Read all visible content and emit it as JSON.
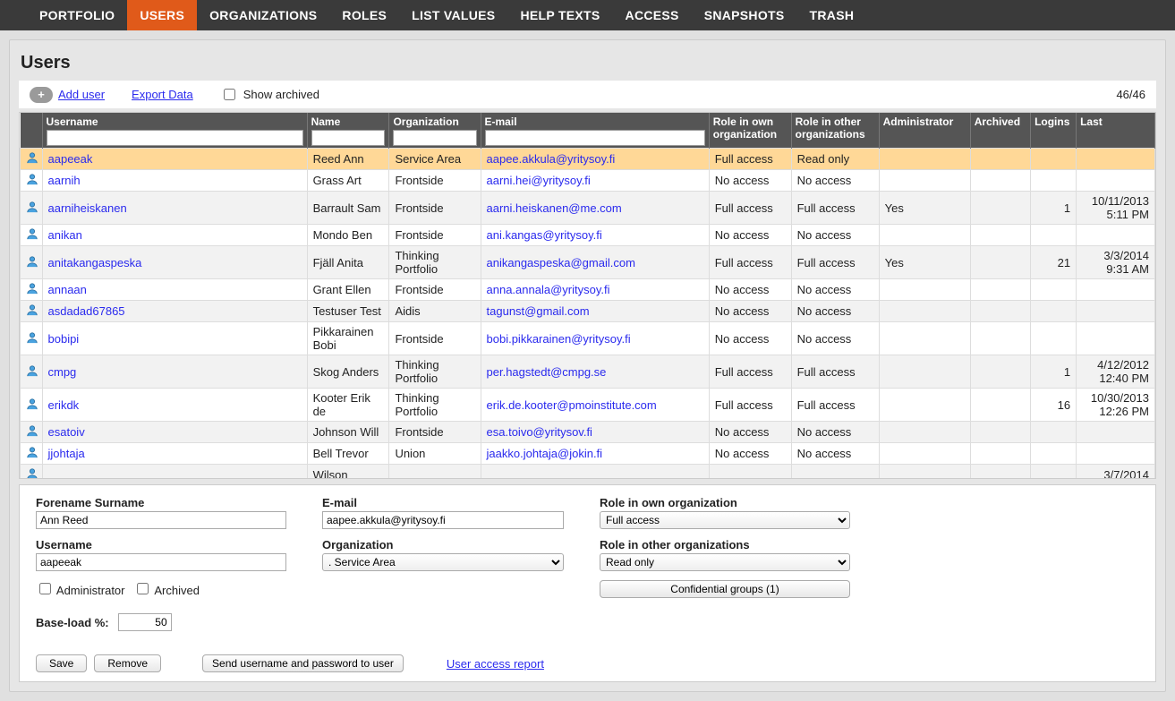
{
  "nav": {
    "items": [
      "PORTFOLIO",
      "USERS",
      "ORGANIZATIONS",
      "ROLES",
      "LIST VALUES",
      "HELP TEXTS",
      "ACCESS",
      "SNAPSHOTS",
      "TRASH"
    ],
    "active_index": 1
  },
  "page_title": "Users",
  "toolbar": {
    "add_user": "Add user",
    "export_data": "Export Data",
    "show_archived_label": "Show archived",
    "show_archived_checked": false,
    "count": "46/46"
  },
  "columns": {
    "username": "Username",
    "name": "Name",
    "organization": "Organization",
    "email": "E-mail",
    "role_own": "Role in own organization",
    "role_other": "Role in other organizations",
    "admin": "Administrator",
    "archived": "Archived",
    "logins": "Logins",
    "last": "Last"
  },
  "rows": [
    {
      "username": "aapeeak",
      "name": "Reed Ann",
      "org": "Service Area",
      "email": "aapee.akkula@yritysoy.fi",
      "role_own": "Full access",
      "role_other": "Read only",
      "admin": "",
      "archived": "",
      "logins": "",
      "last": "",
      "selected": true
    },
    {
      "username": "aarnih",
      "name": "Grass Art",
      "org": "Frontside",
      "email": "aarni.hei@yritysoy.fi",
      "role_own": "No access",
      "role_other": "No access",
      "admin": "",
      "archived": "",
      "logins": "",
      "last": ""
    },
    {
      "username": "aarniheiskanen",
      "name": "Barrault Sam",
      "org": "Frontside",
      "email": "aarni.heiskanen@me.com",
      "role_own": "Full access",
      "role_other": "Full access",
      "admin": "Yes",
      "archived": "",
      "logins": "1",
      "last": "10/11/2013 5:11 PM"
    },
    {
      "username": "anikan",
      "name": "Mondo Ben",
      "org": "Frontside",
      "email": "ani.kangas@yritysoy.fi",
      "role_own": "No access",
      "role_other": "No access",
      "admin": "",
      "archived": "",
      "logins": "",
      "last": ""
    },
    {
      "username": "anitakangaspeska",
      "name": "Fjäll Anita",
      "org": "Thinking Portfolio",
      "email": "anikangaspeska@gmail.com",
      "role_own": "Full access",
      "role_other": "Full access",
      "admin": "Yes",
      "archived": "",
      "logins": "21",
      "last": "3/3/2014 9:31 AM"
    },
    {
      "username": "annaan",
      "name": "Grant Ellen",
      "org": "Frontside",
      "email": "anna.annala@yritysoy.fi",
      "role_own": "No access",
      "role_other": "No access",
      "admin": "",
      "archived": "",
      "logins": "",
      "last": ""
    },
    {
      "username": "asdadad67865",
      "name": "Testuser Test",
      "org": "Aidis",
      "email": "tagunst@gmail.com",
      "role_own": "No access",
      "role_other": "No access",
      "admin": "",
      "archived": "",
      "logins": "",
      "last": ""
    },
    {
      "username": "bobipi",
      "name": "Pikkarainen Bobi",
      "org": "Frontside",
      "email": "bobi.pikkarainen@yritysoy.fi",
      "role_own": "No access",
      "role_other": "No access",
      "admin": "",
      "archived": "",
      "logins": "",
      "last": ""
    },
    {
      "username": "cmpg",
      "name": "Skog Anders",
      "org": "Thinking Portfolio",
      "email": "per.hagstedt@cmpg.se",
      "role_own": "Full access",
      "role_other": "Full access",
      "admin": "",
      "archived": "",
      "logins": "1",
      "last": "4/12/2012 12:40 PM"
    },
    {
      "username": "erikdk",
      "name": "Kooter Erik de",
      "org": "Thinking Portfolio",
      "email": "erik.de.kooter@pmoinstitute.com",
      "role_own": "Full access",
      "role_other": "Full access",
      "admin": "",
      "archived": "",
      "logins": "16",
      "last": "10/30/2013 12:26 PM"
    },
    {
      "username": "esatoiv",
      "name": "Johnson Will",
      "org": "Frontside",
      "email": "esa.toivo@yritysov.fi",
      "role_own": "No access",
      "role_other": "No access",
      "admin": "",
      "archived": "",
      "logins": "",
      "last": ""
    },
    {
      "username": "jjohtaja",
      "name": "Bell Trevor",
      "org": "Union",
      "email": "jaakko.johtaja@jokin.fi",
      "role_own": "No access",
      "role_other": "No access",
      "admin": "",
      "archived": "",
      "logins": "",
      "last": ""
    },
    {
      "username": "",
      "name": "Wilson",
      "org": "",
      "email": "",
      "role_own": "",
      "role_other": "",
      "admin": "",
      "archived": "",
      "logins": "",
      "last": "3/7/2014"
    }
  ],
  "detail": {
    "labels": {
      "forename": "Forename Surname",
      "email": "E-mail",
      "role_own": "Role in own organization",
      "username": "Username",
      "organization": "Organization",
      "role_other": "Role in other organizations",
      "administrator": "Administrator",
      "archived": "Archived",
      "baseload": "Base-load %:",
      "confidential": "Confidential groups (1)",
      "save": "Save",
      "remove": "Remove",
      "send": "Send username and password to user",
      "access_report": "User access report"
    },
    "values": {
      "forename": "Ann Reed",
      "email": "aapee.akkula@yritysoy.fi",
      "role_own": "Full access",
      "username": "aapeeak",
      "organization": ". Service Area",
      "role_other": "Read only",
      "administrator_checked": false,
      "archived_checked": false,
      "baseload": "50"
    }
  }
}
